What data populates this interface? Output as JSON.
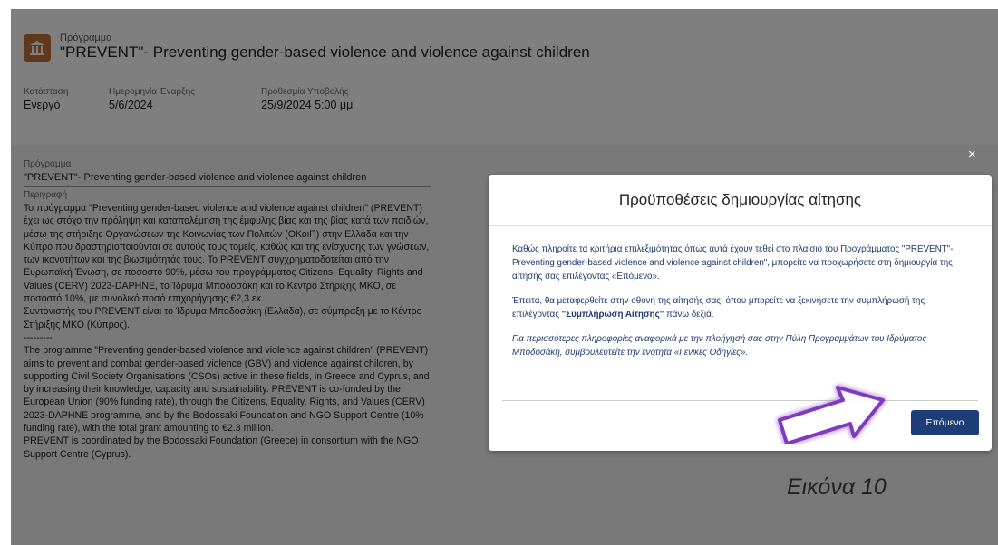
{
  "header": {
    "subtitle": "Πρόγραμμα",
    "title": "\"PREVENT\"- Preventing gender-based violence and violence against children",
    "fields": [
      {
        "label": "Κατάσταση",
        "value": "Ενεργό"
      },
      {
        "label": "Ημερομηνία Έναρξης",
        "value": "5/6/2024"
      },
      {
        "label": "Προθεσμία Υποβολής",
        "value": "25/9/2024 5:00 μμ"
      }
    ]
  },
  "program": {
    "label": "Πρόγραμμα",
    "value": "\"PREVENT\"- Preventing gender-based violence and violence against children"
  },
  "description": {
    "label": "Περιγραφή",
    "paragraphs": [
      "Το πρόγραμμα \"Preventing gender-based violence and violence against children\" (PREVENT) έχει ως στόχο την πρόληψη και καταπολέμηση της έμφυλης βίας και της βίας κατά των παιδιών, μέσω της στήριξης Οργανώσεων της Κοινωνίας των Πολιτών (ΟΚοιΠ) στην Ελλάδα και την Κύπρο που δραστηριοποιούνται σε αυτούς τους τομείς, καθώς και της ενίσχυσης των γνώσεων, των ικανοτήτων και της βιωσιμότητάς τους. Το PREVENT συγχρηματοδοτείται από την Ευρωπαϊκή Ένωση, σε ποσοστό 90%, μέσω του προγράμματος Citizens, Equality, Rights and Values (CERV) 2023-DAPHNE, το Ίδρυμα Μποδοσάκη και το Κέντρο Στήριξης ΜΚΟ, σε ποσοστό 10%, με συνολικό ποσό επιχορήγησης €2,3 εκ.",
      "Συντονιστής του PREVENT είναι το Ίδρυμα Μποδοσάκη (Ελλάδα), σε σύμπραξη με το Κέντρο Στήριξης ΜΚΟ (Κύπρος).",
      "---------",
      "The programme \"Preventing gender-based violence and violence against children\" (PREVENT) aims to prevent and combat gender-based violence (GBV) and violence against children, by supporting Civil Society Organisations (CSOs) active in these fields, in Greece and Cyprus, and by increasing their knowledge, capacity and sustainability. PREVENT is co-funded by the European Union (90% funding rate), through the Citizens, Equality, Rights, and Values (CERV) 2023-DAPHNE programme, and by the Bodossaki Foundation and NGO Support Centre (10% funding rate), with the total grant amounting to €2.3 million.",
      "PREVENT is coordinated by the Bodossaki Foundation (Greece) in consortium with the NGO Support Centre (Cyprus)."
    ]
  },
  "modal": {
    "title": "Προϋποθέσεις δημιουργίας αίτησης",
    "p1": "Καθώς πληροίτε τα κριτήρια επιλεξιμότητας όπως αυτά έχουν τεθεί στο πλαίσιο του Προγράμματος \"PREVENT\"- Preventing gender-based violence and violence against children\", μπορείτε να προχωρήσετε στη δημιουργία της αίτησής σας επιλέγοντας «Επόμενο».",
    "p2_pre": "Έπειτα, θα μεταφερθείτε στην οθόνη της αίτησής σας, όπου μπορείτε να ξεκινήσετε την συμπλήρωσή της επιλέγοντας ",
    "p2_bold": "\"Συμπλήρωση Αίτησης\"",
    "p2_post": " πάνω δεξιά.",
    "p3": "Για περισσότερες πληροφορίες αναφορικά με την πλοήγησή σας στην Πύλη Προγραμμάτων του Ιδρύματος Μποδοσάκη, συμβουλευτείτε την ενότητα «Γενικές Οδηγίες».",
    "next_label": "Επόμενο",
    "close_glyph": "×"
  },
  "caption": "Εικόνα 10",
  "colors": {
    "accent": "#1d3d78",
    "icon_bg": "#c0733a",
    "arrow": "#7b2fbe"
  }
}
